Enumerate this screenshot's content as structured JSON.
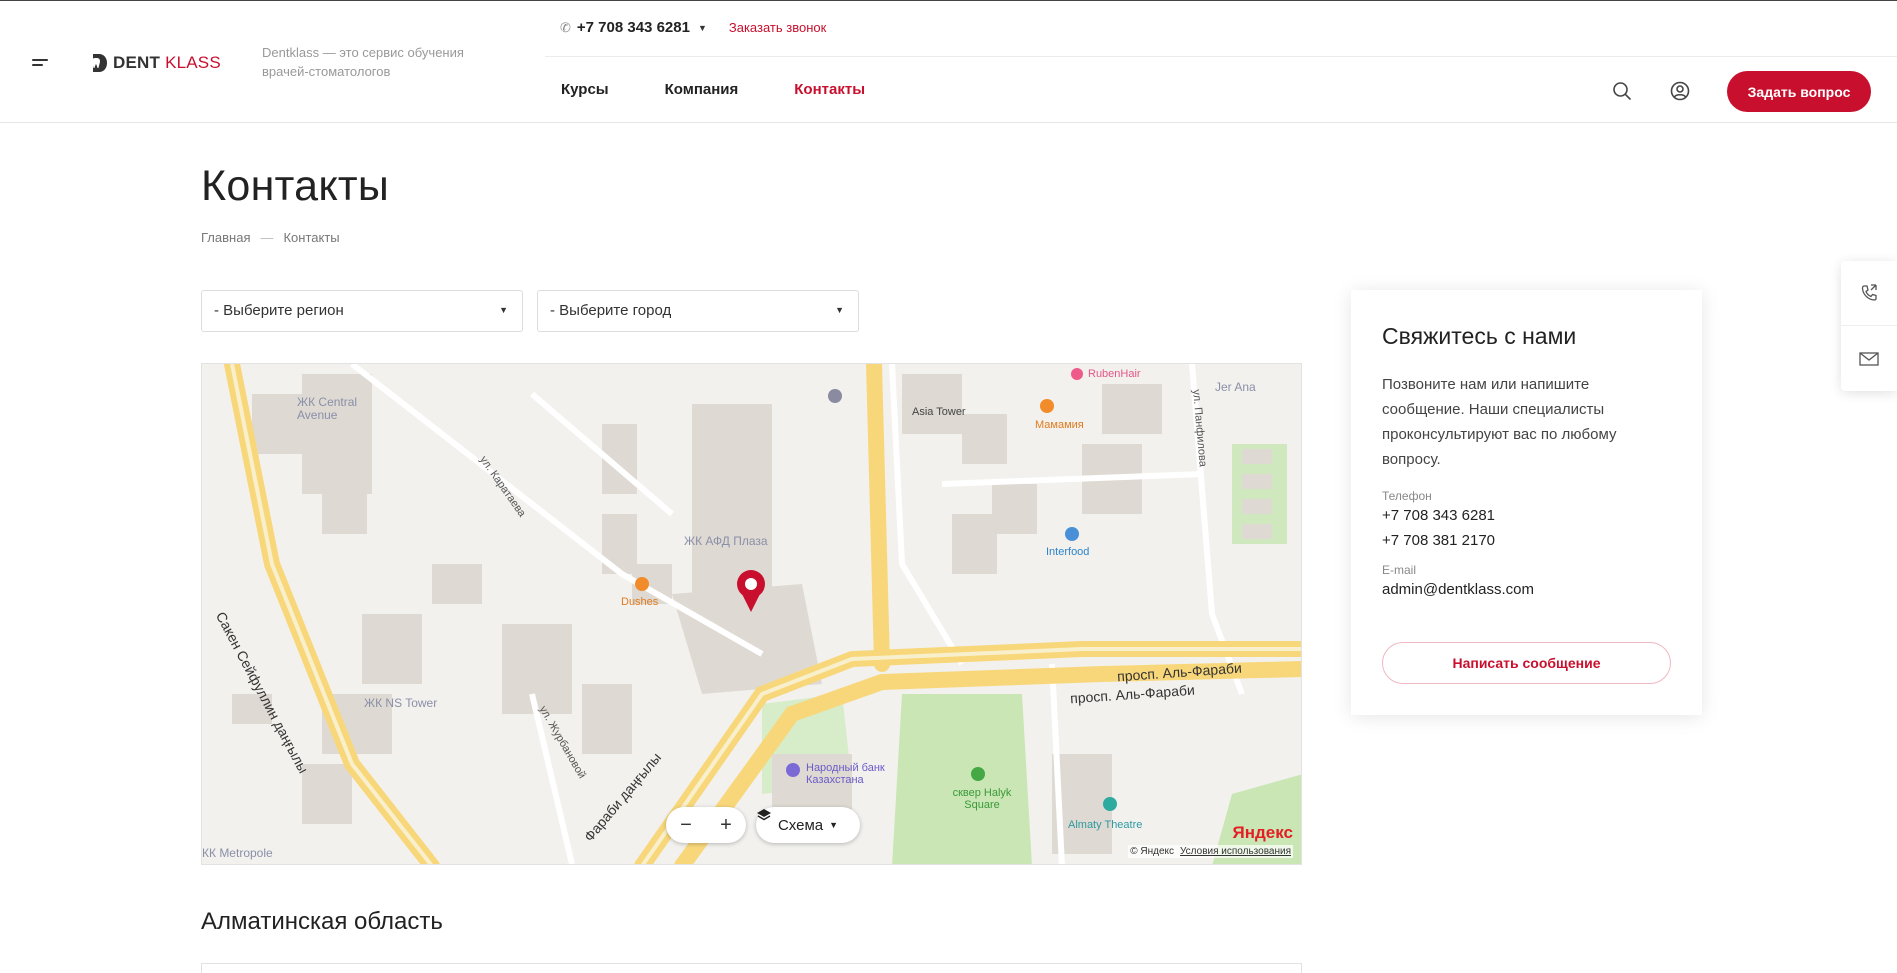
{
  "header": {
    "logo_main": "DENT",
    "logo_accent": "KLASS",
    "tagline": "Dentklass — это сервис обучения врачей-стоматологов",
    "phone": "+7 708 343 6281",
    "callback_label": "Заказать звонок",
    "nav": [
      {
        "label": "Курсы"
      },
      {
        "label": "Компания"
      },
      {
        "label": "Контакты"
      }
    ],
    "ask_button": "Задать вопрос"
  },
  "page": {
    "title": "Контакты",
    "breadcrumb": {
      "home": "Главная",
      "separator": "—",
      "current": "Контакты"
    }
  },
  "filters": {
    "region_selected": "- Выберите регион",
    "city_selected": "- Выберите город"
  },
  "map": {
    "labels": {
      "central_avenue": "ЖК Central Avenue",
      "afd_plaza": "ЖК АФД Плаза",
      "ns_tower": "ЖК NS Tower",
      "metropole": "КК Metropole",
      "asia_tower": "Asia Tower",
      "mamamia": "Мамамия",
      "rubenhair": "RubenHair",
      "interfood": "Interfood",
      "dushes": "Dushes",
      "narodny_bank": "Народный банк Казахстана",
      "halyk_square": "сквер Halyk Square",
      "almaty_theatre": "Almaty Theatre",
      "jer_ana": "Jer Ana",
      "road_alfarabi": "просп. Аль-Фараби",
      "road_alfarabi_kz": "Фараби даңғылы",
      "road_seifullin": "Сакен Сейфуллин даңғылы",
      "street_karataeva": "ул. Каратаева",
      "street_zhurbanova": "ул. Журбановой",
      "street_panfilova": "ул. Панфилова"
    },
    "layer_label": "Схема",
    "logo": "Яндекс",
    "copyright": "© Яндекс",
    "terms": "Условия использования"
  },
  "contact_card": {
    "title": "Свяжитесь с нами",
    "description": "Позвоните нам или напишите сообщение. Наши специалисты проконсультируют вас по любому вопросу.",
    "phone_label": "Телефон",
    "phones": [
      "+7 708 343 6281",
      "+7 708 381 2170"
    ],
    "email_label": "E-mail",
    "email": "admin@dentklass.com",
    "button": "Написать сообщение"
  },
  "section_title": "Алматинская область",
  "colors": {
    "accent": "#c8102e",
    "map_road": "#f8d77b",
    "map_building": "#dedad3",
    "map_park": "#c9e6b4"
  }
}
